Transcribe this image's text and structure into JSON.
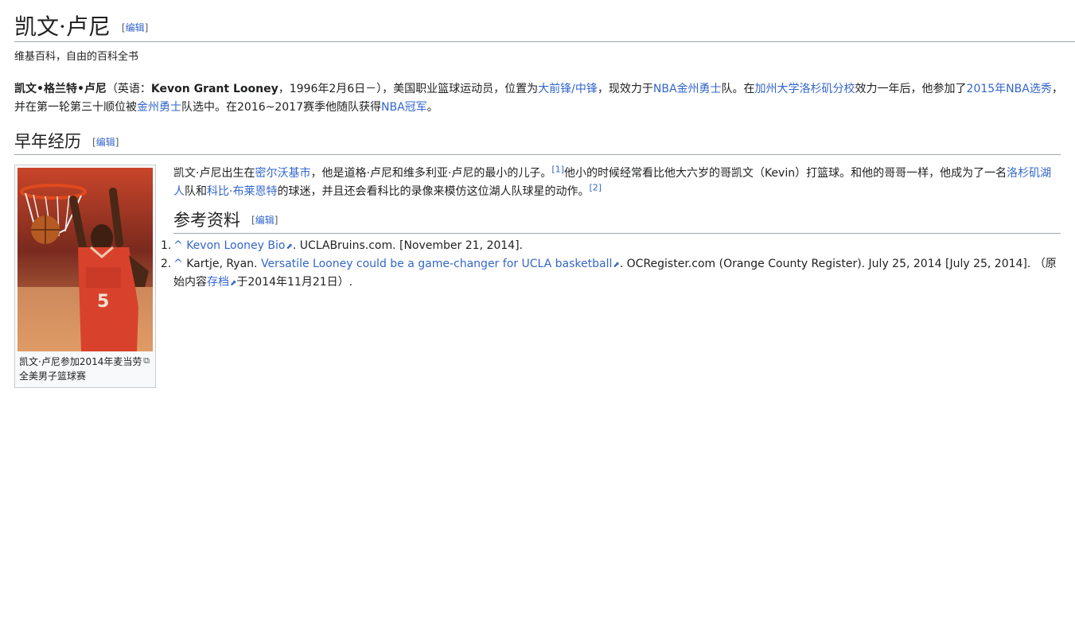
{
  "title": "凯文·卢尼",
  "edit_label": "编辑",
  "site_sub": "维基百科，自由的百科全书",
  "lead": {
    "bold_name": "凯文•格兰特•卢尼",
    "t1": "（英语：",
    "bold_en": "Kevon Grant Looney",
    "t2": "，1996年2月6日－），美国职业",
    "link_basketball": "篮球",
    "t3": "运动员，位置为",
    "link_pf": "大前锋",
    "slash": "/",
    "link_c": "中锋",
    "t4": "，现效力于",
    "link_nba": "NBA",
    "link_gsw": "金州勇士",
    "t5": "队。在",
    "link_ucla": "加州大学洛杉矶分校",
    "t6": "效力一年后，他参加了",
    "link_draft": "2015年NBA选秀",
    "t7": "，并在第一轮第三十顺位被",
    "link_gsw2": "金州勇士",
    "t8": "队选中。在2016~2017赛季他随队获得",
    "link_champ": "NBA冠军",
    "t9": "。"
  },
  "early": {
    "heading": "早年经历",
    "t1": "凯文·卢尼出生在",
    "link_city": "密尔沃基市",
    "t2": "，他是道格·卢尼和维多利亚·卢尼的最小的儿子。",
    "ref1": "[1]",
    "t3": "他小的时候经常看比他大六岁的哥凯文（Kevin）打篮球。和他的哥哥一样，他成为了一名",
    "link_lakers": "洛杉矶湖人",
    "t4": "队和",
    "link_kobe": "科比·布莱恩特",
    "t5": "的球迷，并且还会看科比的录像来模仿这位湖人队球星的动作。",
    "ref2": "[2]"
  },
  "thumb": {
    "caption": "凯文·卢尼参加2014年麦当劳全美男子篮球赛",
    "jersey_text": "5",
    "magnify_icon": "magnify-icon"
  },
  "refs": {
    "heading": "参考资料",
    "items": [
      {
        "num": "1.",
        "caret": "^",
        "link": "Kevon Looney Bio",
        "rest": ". UCLABruins.com. [November 21, 2014]."
      },
      {
        "num": "2.",
        "caret": "^",
        "pre": "Kartje, Ryan. ",
        "link": "Versatile Looney could be a game-changer for UCLA basketball",
        "rest": ". OCRegister.com (Orange County Register). July 25, 2014 [July 25, 2014]. （原始内容",
        "archive": "存档",
        "tail": "于2014年11月21日）."
      }
    ]
  }
}
